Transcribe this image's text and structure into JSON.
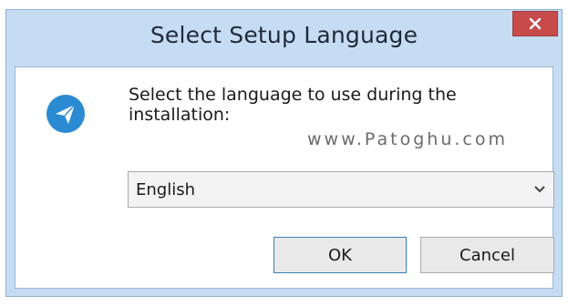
{
  "window": {
    "title": "Select Setup Language",
    "close_icon": "close-icon"
  },
  "dialog": {
    "icon": "setup-icon",
    "prompt": "Select the language to use during the installation:",
    "watermark": "www.Patoghu.com",
    "language_select": {
      "selected": "English",
      "arrow_icon": "chevron-down-icon"
    },
    "buttons": {
      "ok": "OK",
      "cancel": "Cancel"
    }
  },
  "colors": {
    "titlebar": "#c5dcf2",
    "close": "#c74b4b",
    "icon": "#2a8bd2",
    "focus_border": "#3c7fb1"
  }
}
